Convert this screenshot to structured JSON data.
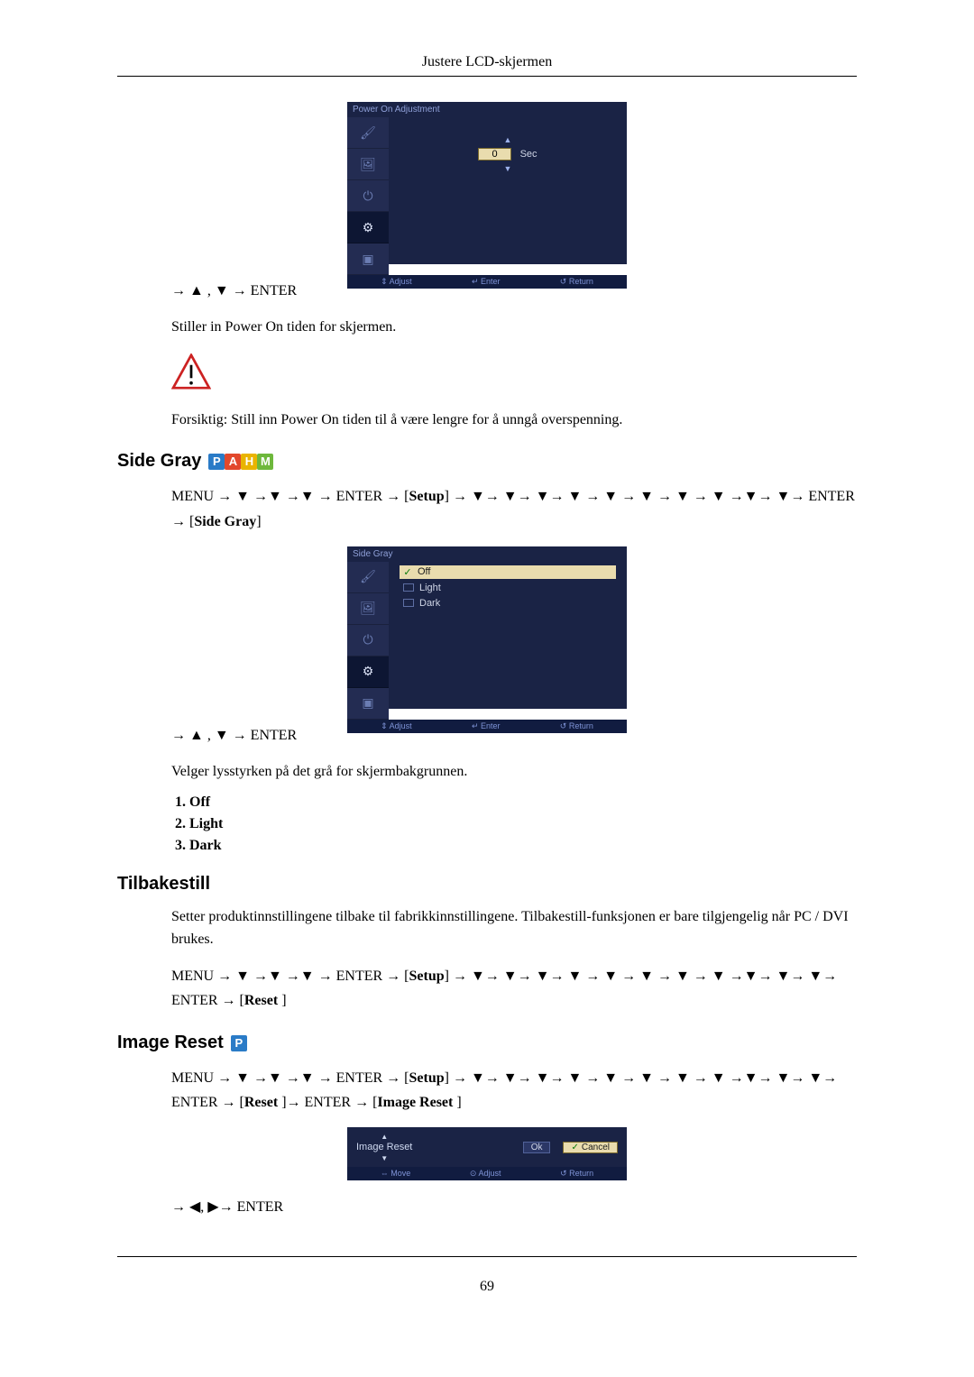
{
  "header": {
    "title": "Justere LCD-skjermen"
  },
  "pageNumber": "69",
  "osd1": {
    "title": "Power On Adjustment",
    "value": "0",
    "unit": "Sec",
    "footer": {
      "adjust": "⇕ Adjust",
      "enter": "↵ Enter",
      "return": "↺ Return"
    }
  },
  "powerOn": {
    "nav1": "→ ▲ , ▼ → ENTER",
    "desc": "Stiller in Power On tiden for skjermen.",
    "caution": "Forsiktig: Still inn Power On tiden til å være lengre for å unngå overspenning."
  },
  "sideGray": {
    "heading": "Side Gray",
    "navMenu": "MENU → ▼ →▼ →▼ → ENTER → [Setup] → ▼→ ▼→ ▼→ ▼ → ▼ → ▼ → ▼ → ▼ →▼→ ▼→ ENTER → [Side Gray]",
    "nav2": "→ ▲ , ▼ → ENTER",
    "desc": "Velger lysstyrken på det grå for skjermbakgrunnen.",
    "options": [
      "Off",
      "Light",
      "Dark"
    ]
  },
  "osd2": {
    "title": "Side Gray",
    "items": [
      {
        "label": "Off",
        "selected": true
      },
      {
        "label": "Light",
        "selected": false
      },
      {
        "label": "Dark",
        "selected": false
      }
    ],
    "footer": {
      "adjust": "⇕ Adjust",
      "enter": "↵ Enter",
      "return": "↺ Return"
    }
  },
  "tilbakestill": {
    "heading": "Tilbakestill",
    "desc_a": "Setter produktinnstillingene tilbake til fabrikkinnstillingene. Tilbakestill-funksjonen er bare tilgjengelig når ",
    "desc_bold": "PC / DVI",
    "desc_b": " brukes.",
    "navMenu": "MENU → ▼ →▼ →▼ → ENTER → [Setup] → ▼→ ▼→ ▼→ ▼ → ▼ → ▼ → ▼ → ▼ →▼→ ▼→ ▼→ ENTER → [Reset ]"
  },
  "imageReset": {
    "heading": "Image Reset",
    "navMenu": "MENU → ▼ →▼ →▼ → ENTER → [Setup] → ▼→ ▼→ ▼→ ▼ → ▼ → ▼ → ▼ → ▼ →▼→ ▼→ ▼→ ENTER → [Reset ]→ ENTER → [Image Reset ]",
    "nav2": "→ ◀, ▶→ ENTER"
  },
  "osd3": {
    "title": "Image Reset",
    "ok": "Ok",
    "cancel": "Cancel",
    "footer": {
      "move": "⇔ Move",
      "adjust": "⊙ Adjust",
      "return": "↺ Return"
    }
  }
}
